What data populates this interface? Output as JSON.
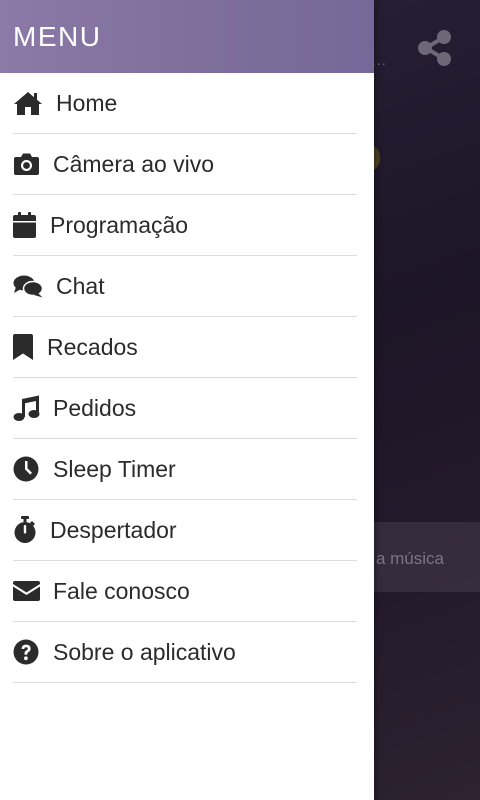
{
  "drawer": {
    "title": "MENU",
    "items": [
      {
        "label": "Home",
        "icon": "home-icon"
      },
      {
        "label": "Câmera ao vivo",
        "icon": "camera-icon"
      },
      {
        "label": "Programação",
        "icon": "calendar-icon"
      },
      {
        "label": "Chat",
        "icon": "chat-icon"
      },
      {
        "label": "Recados",
        "icon": "bookmark-icon"
      },
      {
        "label": "Pedidos",
        "icon": "music-note-icon"
      },
      {
        "label": "Sleep Timer",
        "icon": "clock-icon"
      },
      {
        "label": "Despertador",
        "icon": "stopwatch-icon"
      },
      {
        "label": "Fale conosco",
        "icon": "envelope-icon"
      },
      {
        "label": "Sobre o aplicativo",
        "icon": "question-circle-icon"
      }
    ]
  },
  "background": {
    "banner_text": "a música",
    "more_text": "..."
  },
  "colors": {
    "header": "#8b7aa7",
    "icon": "#2b2b2b",
    "divider": "#dcdcdc"
  }
}
